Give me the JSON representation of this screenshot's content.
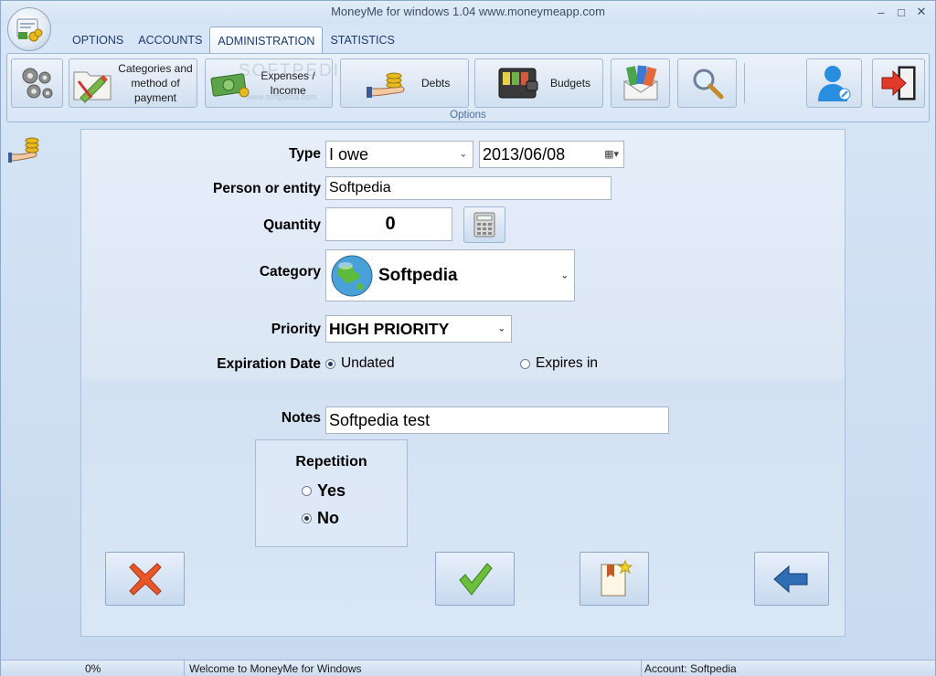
{
  "window": {
    "title": "MoneyMe for windows 1.04 www.moneymeapp.com",
    "controls": {
      "minimize": "‒",
      "maximize": "□",
      "close": "✕"
    }
  },
  "tabs": [
    {
      "label": "OPTIONS"
    },
    {
      "label": "ACCOUNTS"
    },
    {
      "label": "ADMINISTRATION",
      "active": true
    },
    {
      "label": "STATISTICS"
    }
  ],
  "ribbon": {
    "group_label": "Options",
    "categories_label": "Categories and method of payment",
    "expenses_label": "Expenses / Income",
    "debts_label": "Debts",
    "budgets_label": "Budgets",
    "watermark": "SOFTPEDIA",
    "watermark_sub": "www.softpedia.com"
  },
  "form": {
    "type_label": "Type",
    "type_value": "I owe",
    "date_value": "2013/06/08",
    "person_label": "Person or entity",
    "person_value": "Softpedia",
    "quantity_label": "Quantity",
    "quantity_value": "0",
    "category_label": "Category",
    "category_value": "Softpedia",
    "priority_label": "Priority",
    "priority_value": "HIGH PRIORITY",
    "expiration_label": "Expiration Date",
    "exp_undated": "Undated",
    "exp_expires": "Expires in",
    "notes_label": "Notes",
    "notes_value": "Softpedia test",
    "repetition_label": "Repetition",
    "rep_yes": "Yes",
    "rep_no": "No"
  },
  "status": {
    "progress": "0%",
    "message": "Welcome to MoneyMe for Windows",
    "account": "Account: Softpedia"
  },
  "colors": {
    "accent": "#1e3a6a",
    "cancel": "#e8572a",
    "confirm": "#6cbf3a",
    "back": "#2f6db5"
  }
}
